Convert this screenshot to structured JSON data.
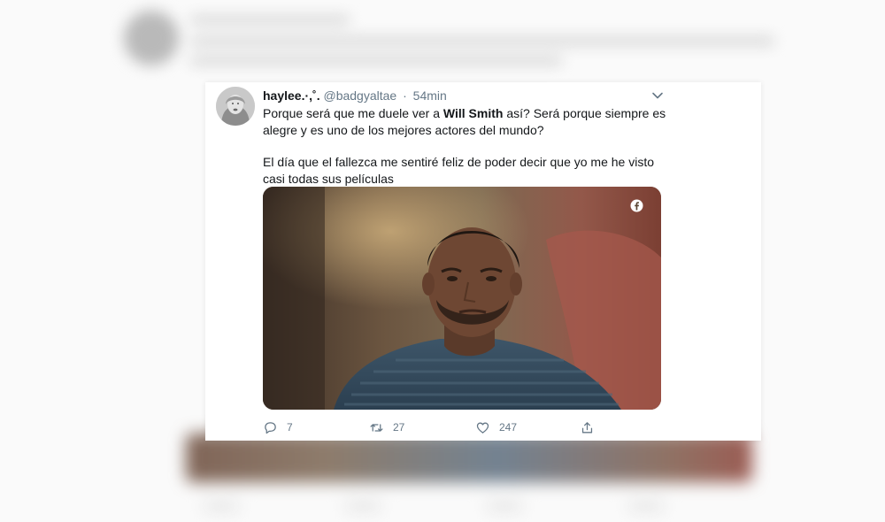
{
  "tweet": {
    "display_name": "haylee.·,˚.",
    "handle": "@badgyaltae",
    "separator": "·",
    "time": "54min",
    "text_line1_before": "Porque será que me duele ver a ",
    "text_line1_bold": "Will Smith",
    "text_line1_after": " así? Será porque siempre es alegre y es uno de los mejores actores del mundo?",
    "text_paragraph2": "El día que el fallezca me sentiré feliz de poder decir que yo me he visto casi todas sus películas"
  },
  "actions": {
    "reply_count": "7",
    "retweet_count": "27",
    "like_count": "247"
  },
  "icons": {
    "caret": "chevron-down-icon",
    "media_badge": "facebook-icon",
    "reply": "reply-icon",
    "retweet": "retweet-icon",
    "like": "heart-icon",
    "share": "share-icon"
  },
  "colors": {
    "text_primary": "#14171a",
    "text_secondary": "#657786"
  }
}
